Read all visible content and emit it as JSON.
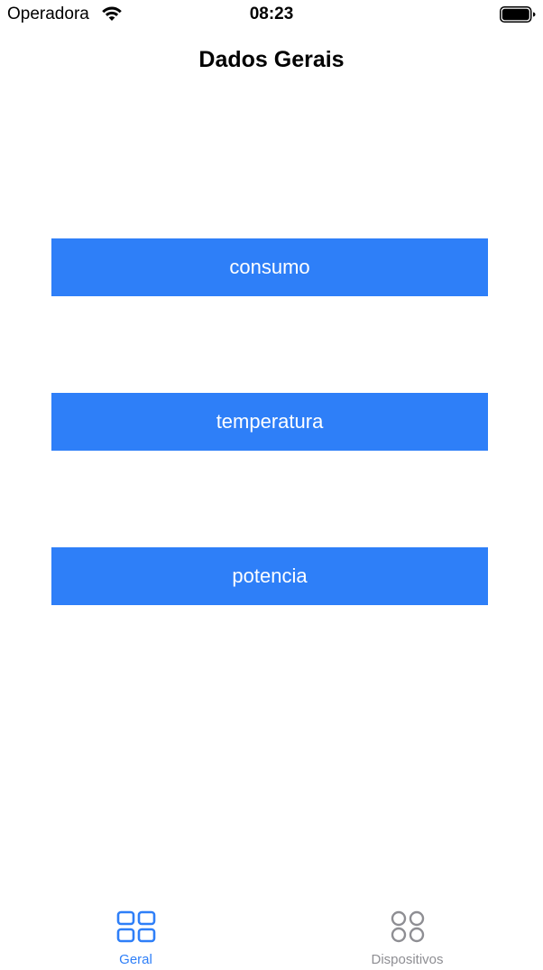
{
  "status_bar": {
    "carrier": "Operadora",
    "time": "08:23"
  },
  "nav": {
    "title": "Dados Gerais"
  },
  "buttons": [
    {
      "label": "consumo"
    },
    {
      "label": "temperatura"
    },
    {
      "label": "potencia"
    }
  ],
  "tab_bar": {
    "tabs": [
      {
        "label": "Geral",
        "icon": "grid-icon",
        "selected": true
      },
      {
        "label": "Dispositivos",
        "icon": "circles-icon",
        "selected": false
      }
    ],
    "active_color": "#2e7ff8",
    "inactive_color": "#8e8e93"
  },
  "accent_color": "#2e7ff8"
}
